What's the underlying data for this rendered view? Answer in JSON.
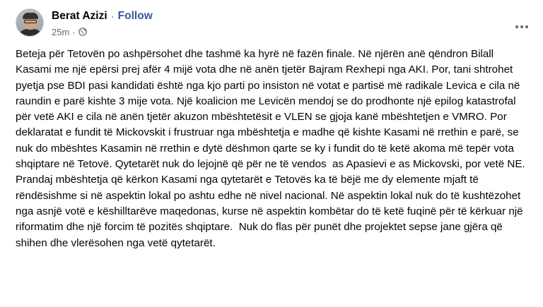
{
  "post": {
    "author": "Berat Azizi",
    "separator": "·",
    "follow_label": "Follow",
    "timestamp": "25m",
    "time_separator": "·",
    "audience_icon": "globe-icon",
    "more_icon": "more-options-icon",
    "text": "Beteja për Tetovën po ashpërsohet dhe tashmë ka hyrë në fazën finale. Në njërën anë qëndron Bilall Kasami me një epërsi prej afër 4 mijë vota dhe në anën tjetër Bajram Rexhepi nga AKI. Por, tani shtrohet pyetja pse BDI pasi kandidati është nga kjo parti po insiston në votat e partisë më radikale Levica e cila në raundin e parë kishte 3 mije vota. Një koalicion me Levicën mendoj se do prodhonte një epilog katastrofal për vetë AKI e cila në anën tjetër akuzon mbështetësit e VLEN se gjoja kanë mbështetjen e VMRO. Por deklaratat e fundit të Mickovskit i frustruar nga mbështetja e madhe që kishte Kasami në rrethin e parë, se nuk do mbështes Kasamin në rrethin e dytë dëshmon qarte se ky i fundit do të ketë akoma më tepër vota shqiptare në Tetovë. Qytetarët nuk do lejojnë që për ne të vendos  as Apasievi e as Mickovski, por vetë NE. Prandaj mbështetja që kërkon Kasami nga qytetarët e Tetovës ka të bëjë me dy elemente mjaft të rëndësishme si në aspektin lokal po ashtu edhe në nivel nacional. Në aspektin lokal nuk do të kushtëzohet nga asnjë votë e këshilltarëve maqedonas, kurse në aspektin kombëtar do të ketë fuqinë për të kërkuar një riformatim dhe një forcim të pozitës shqiptare.  Nuk do flas për punët dhe projektet sepse jane gjëra që shihen dhe vlerësohen nga vetë qytetarët."
  },
  "colors": {
    "follow": "#385898",
    "secondary_text": "#65676b",
    "primary_text": "#050505"
  }
}
